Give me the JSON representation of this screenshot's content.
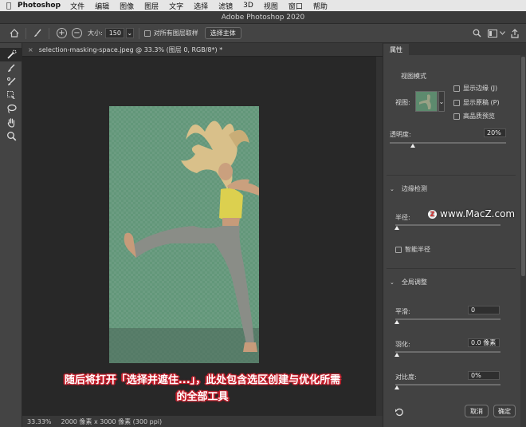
{
  "menubar": {
    "app": "Photoshop",
    "items": [
      "文件",
      "编辑",
      "图像",
      "图层",
      "文字",
      "选择",
      "滤镜",
      "3D",
      "视图",
      "窗口",
      "帮助"
    ]
  },
  "window": {
    "title": "Adobe Photoshop 2020"
  },
  "options": {
    "size_label": "大小:",
    "size_value": "150",
    "sample_all_layers": "对所有图层取样",
    "select_subject": "选择主体"
  },
  "document": {
    "tab": "selection-masking-space.jpeg @ 33.3% (图层 0, RGB/8*) *",
    "zoom": "33.33%",
    "info": "2000 像素 x 3000 像素 (300 ppi)"
  },
  "panel": {
    "tab": "属性",
    "view_mode": {
      "title": "视图模式",
      "view_label": "视图:",
      "show_edge": "显示边缘 (J)",
      "show_original": "显示原稿 (P)",
      "hq_preview": "高品质预览"
    },
    "opacity": {
      "label": "透明度:",
      "value": "20%",
      "level_pct": 20
    },
    "edge_detection": {
      "title": "边缘检测",
      "radius_label": "半径:",
      "smart_radius": "智能半径",
      "level_pct": 0
    },
    "global_refinements": {
      "title": "全局调整",
      "smooth": {
        "label": "平滑:",
        "value": "0",
        "level_pct": 0
      },
      "feather": {
        "label": "羽化:",
        "value": "0.0 像素",
        "level_pct": 0
      },
      "contrast": {
        "label": "对比度:",
        "value": "0%",
        "level_pct": 0
      }
    },
    "cancel": "取消",
    "ok": "确定"
  },
  "watermark": "www.MacZ.com",
  "caption": {
    "line1": "随后将打开「选择并遮住...」，此处包含选区创建与优化所需",
    "line2": "的全部工具"
  },
  "colors": {
    "canvas_overlay": "#63977a",
    "caption_outline": "#c41f2c"
  }
}
